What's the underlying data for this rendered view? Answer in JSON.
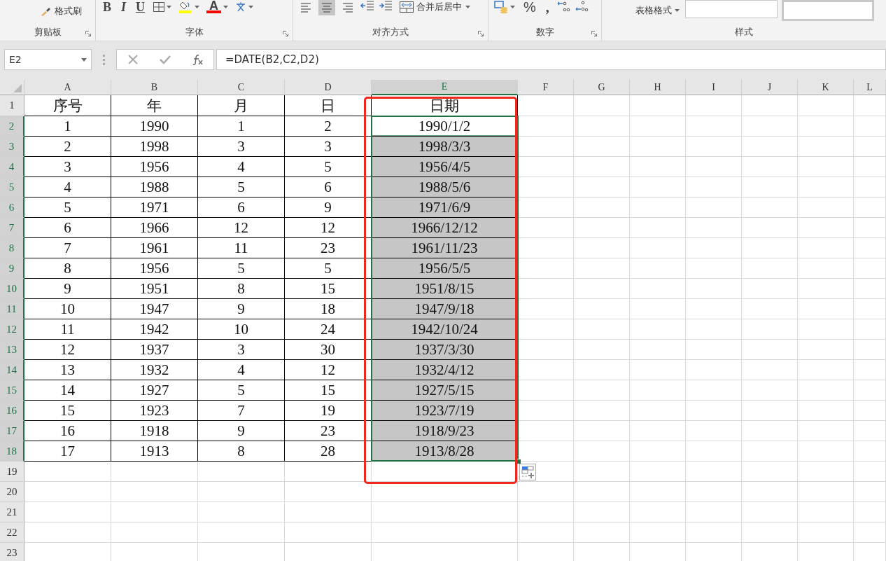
{
  "ribbon": {
    "groups": [
      {
        "label": "剪贴板",
        "items": [
          {
            "kind": "brush",
            "label": "格式刷"
          }
        ]
      },
      {
        "label": "字体",
        "items": [
          {
            "kind": "bold",
            "label": "B"
          },
          {
            "kind": "italic",
            "label": "I"
          },
          {
            "kind": "underline",
            "label": "U"
          },
          {
            "kind": "borders"
          },
          {
            "kind": "fill-color",
            "color": "#ffff00"
          },
          {
            "kind": "font-color",
            "label": "A",
            "color": "#ff0000"
          },
          {
            "kind": "phonetic"
          }
        ]
      },
      {
        "label": "对齐方式",
        "items": [
          {
            "kind": "align-left",
            "selected": false
          },
          {
            "kind": "align-center",
            "selected": true
          },
          {
            "kind": "align-right",
            "selected": false
          },
          {
            "kind": "outdent"
          },
          {
            "kind": "indent"
          },
          {
            "kind": "merge",
            "label": "合并后居中"
          }
        ]
      },
      {
        "label": "数字",
        "items": [
          {
            "kind": "accounting"
          },
          {
            "kind": "percent",
            "label": "%"
          },
          {
            "kind": "comma",
            "label": ","
          },
          {
            "kind": "inc-decimal"
          },
          {
            "kind": "dec-decimal"
          }
        ]
      },
      {
        "label": "样式",
        "items": [
          {
            "kind": "table-format",
            "label": "表格格式"
          },
          {
            "kind": "style-box"
          },
          {
            "kind": "style-box"
          }
        ]
      }
    ]
  },
  "name_box": {
    "value": "E2"
  },
  "formula_bar": {
    "value": "=DATE(B2,C2,D2)"
  },
  "columns": [
    {
      "label": "A",
      "selected": false
    },
    {
      "label": "B",
      "selected": false
    },
    {
      "label": "C",
      "selected": false
    },
    {
      "label": "D",
      "selected": false
    },
    {
      "label": "E",
      "selected": true
    },
    {
      "label": "F",
      "selected": false
    },
    {
      "label": "G",
      "selected": false
    },
    {
      "label": "H",
      "selected": false
    },
    {
      "label": "I",
      "selected": false
    },
    {
      "label": "J",
      "selected": false
    },
    {
      "label": "K",
      "selected": false
    },
    {
      "label": "L",
      "selected": false
    }
  ],
  "rows": [
    {
      "header": "1",
      "selected": false,
      "active": false,
      "cells": [
        "序号",
        "年",
        "月",
        "日",
        "日期"
      ]
    },
    {
      "header": "2",
      "selected": true,
      "active": true,
      "cells": [
        "1",
        "1990",
        "1",
        "2",
        "1990/1/2"
      ]
    },
    {
      "header": "3",
      "selected": true,
      "active": false,
      "cells": [
        "2",
        "1998",
        "3",
        "3",
        "1998/3/3"
      ]
    },
    {
      "header": "4",
      "selected": true,
      "active": false,
      "cells": [
        "3",
        "1956",
        "4",
        "5",
        "1956/4/5"
      ]
    },
    {
      "header": "5",
      "selected": true,
      "active": false,
      "cells": [
        "4",
        "1988",
        "5",
        "6",
        "1988/5/6"
      ]
    },
    {
      "header": "6",
      "selected": true,
      "active": false,
      "cells": [
        "5",
        "1971",
        "6",
        "9",
        "1971/6/9"
      ]
    },
    {
      "header": "7",
      "selected": true,
      "active": false,
      "cells": [
        "6",
        "1966",
        "12",
        "12",
        "1966/12/12"
      ]
    },
    {
      "header": "8",
      "selected": true,
      "active": false,
      "cells": [
        "7",
        "1961",
        "11",
        "23",
        "1961/11/23"
      ]
    },
    {
      "header": "9",
      "selected": true,
      "active": false,
      "cells": [
        "8",
        "1956",
        "5",
        "5",
        "1956/5/5"
      ]
    },
    {
      "header": "10",
      "selected": true,
      "active": false,
      "cells": [
        "9",
        "1951",
        "8",
        "15",
        "1951/8/15"
      ]
    },
    {
      "header": "11",
      "selected": true,
      "active": false,
      "cells": [
        "10",
        "1947",
        "9",
        "18",
        "1947/9/18"
      ]
    },
    {
      "header": "12",
      "selected": true,
      "active": false,
      "cells": [
        "11",
        "1942",
        "10",
        "24",
        "1942/10/24"
      ]
    },
    {
      "header": "13",
      "selected": true,
      "active": false,
      "cells": [
        "12",
        "1937",
        "3",
        "30",
        "1937/3/30"
      ]
    },
    {
      "header": "14",
      "selected": true,
      "active": false,
      "cells": [
        "13",
        "1932",
        "4",
        "12",
        "1932/4/12"
      ]
    },
    {
      "header": "15",
      "selected": true,
      "active": false,
      "cells": [
        "14",
        "1927",
        "5",
        "15",
        "1927/5/15"
      ]
    },
    {
      "header": "16",
      "selected": true,
      "active": false,
      "cells": [
        "15",
        "1923",
        "7",
        "19",
        "1923/7/19"
      ]
    },
    {
      "header": "17",
      "selected": true,
      "active": false,
      "cells": [
        "16",
        "1918",
        "9",
        "23",
        "1918/9/23"
      ]
    },
    {
      "header": "18",
      "selected": true,
      "active": false,
      "cells": [
        "17",
        "1913",
        "8",
        "28",
        "1913/8/28"
      ]
    },
    {
      "header": "19",
      "selected": false,
      "active": false,
      "cells": []
    },
    {
      "header": "20",
      "selected": false,
      "active": false,
      "cells": []
    },
    {
      "header": "21",
      "selected": false,
      "active": false,
      "cells": []
    },
    {
      "header": "22",
      "selected": false,
      "active": false,
      "cells": []
    },
    {
      "header": "23",
      "selected": false,
      "active": false,
      "cells": []
    }
  ]
}
